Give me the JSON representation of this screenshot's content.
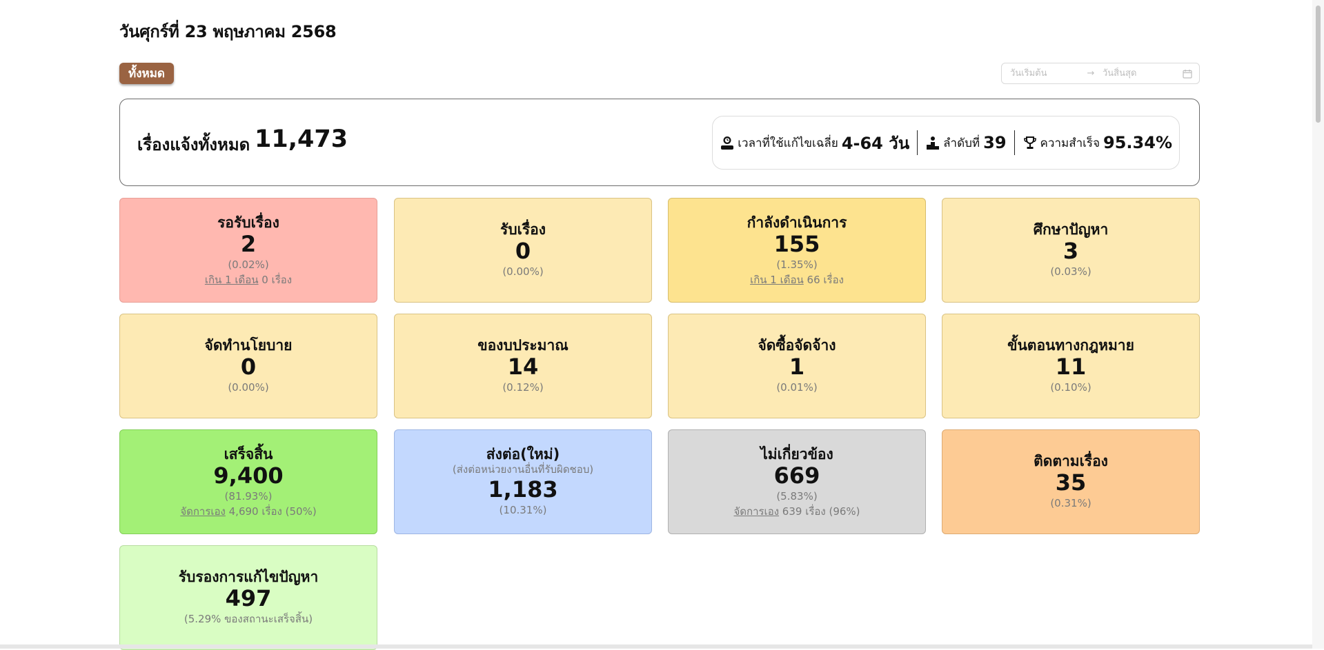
{
  "header": {
    "date_title": "วันศุกร์ที่ 23 พฤษภาคม 2568"
  },
  "filter": {
    "all_button": "ทั้งหมด",
    "start_placeholder": "วันเริ่มต้น",
    "end_placeholder": "วันสิ้นสุด",
    "arrow": "→"
  },
  "summary": {
    "total_label": "เรื่องแจ้งทั้งหมด",
    "total_value": "11,473",
    "avg_time_label": "เวลาที่ใช้แก้ไขเฉลี่ย",
    "avg_time_value": "4-64 วัน",
    "rank_label": "ลำดับที่",
    "rank_value": "39",
    "success_label": "ความสำเร็จ",
    "success_value": "95.34%"
  },
  "cards": [
    {
      "title": "รอรับเรื่อง",
      "value": "2",
      "pct": "(0.02%)",
      "note_link": "เกิน 1 เดือน",
      "note_text": " 0 เรื่อง"
    },
    {
      "title": "รับเรื่อง",
      "value": "0",
      "pct": "(0.00%)"
    },
    {
      "title": "กำลังดำเนินการ",
      "value": "155",
      "pct": "(1.35%)",
      "note_link": "เกิน 1 เดือน",
      "note_text": " 66 เรื่อง"
    },
    {
      "title": "ศึกษาปัญหา",
      "value": "3",
      "pct": "(0.03%)"
    },
    {
      "title": "จัดทำนโยบาย",
      "value": "0",
      "pct": "(0.00%)"
    },
    {
      "title": "ของบประมาณ",
      "value": "14",
      "pct": "(0.12%)"
    },
    {
      "title": "จัดซื้อจัดจ้าง",
      "value": "1",
      "pct": "(0.01%)"
    },
    {
      "title": "ขั้นตอนทางกฎหมาย",
      "value": "11",
      "pct": "(0.10%)"
    },
    {
      "title": "เสร็จสิ้น",
      "value": "9,400",
      "pct": "(81.93%)",
      "note_link": "จัดการเอง",
      "note_text": " 4,690 เรื่อง (50%)"
    },
    {
      "title": "ส่งต่อ(ใหม่)",
      "sub": "(ส่งต่อหน่วยงานอื่นที่รับผิดชอบ)",
      "value": "1,183",
      "pct": "(10.31%)"
    },
    {
      "title": "ไม่เกี่ยวข้อง",
      "value": "669",
      "pct": "(5.83%)",
      "note_link": "จัดการเอง",
      "note_text": " 639 เรื่อง (96%)"
    },
    {
      "title": "ติดตามเรื่อง",
      "value": "35",
      "pct": "(0.31%)"
    },
    {
      "title": "รับรองการแก้ไขปัญหา",
      "value": "497",
      "pct": "(5.29% ของสถานะเสร็จสิ้น)"
    }
  ],
  "colors": {
    "all_button": "#9a6342",
    "waiting": "#ffb8b0",
    "neutral": "#fdeab4",
    "in_progress": "#fde38f",
    "done": "#a3f076",
    "forwarded": "#c3d8fe",
    "unrelated": "#d9d9d9",
    "follow_up": "#fdcb94",
    "certified": "#d9fdc3"
  }
}
